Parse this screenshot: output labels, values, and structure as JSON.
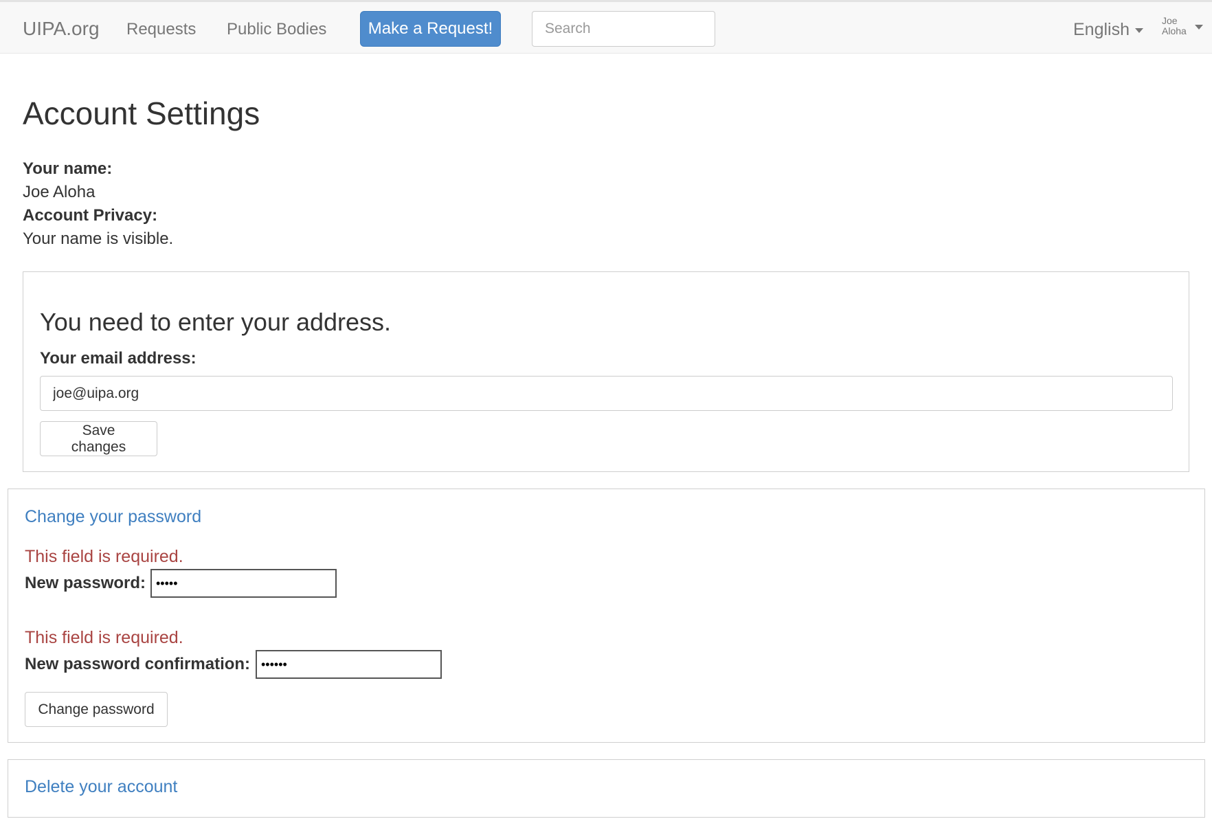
{
  "navbar": {
    "brand": "UIPA.org",
    "links": [
      {
        "label": "Requests"
      },
      {
        "label": "Public Bodies"
      }
    ],
    "make_request_label": "Make a Request!",
    "search": {
      "placeholder": "Search",
      "value": ""
    },
    "language": "English",
    "user": "Joe Aloha"
  },
  "page": {
    "title": "Account Settings",
    "name_label": "Your name:",
    "name_value": "Joe Aloha",
    "privacy_label": "Account Privacy:",
    "privacy_value": "Your name is visible."
  },
  "address_panel": {
    "heading": "You need to enter your address.",
    "email_label": "Your email address:",
    "email_value": "joe@uipa.org",
    "save_label": "Save changes"
  },
  "password_panel": {
    "heading": "Change your password",
    "fields": [
      {
        "error": "This field is required.",
        "label": "New password:",
        "value": "•••••"
      },
      {
        "error": "This field is required.",
        "label": "New password confirmation:",
        "value": "••••••"
      }
    ],
    "submit_label": "Change password"
  },
  "delete_panel": {
    "heading": "Delete your account"
  }
}
